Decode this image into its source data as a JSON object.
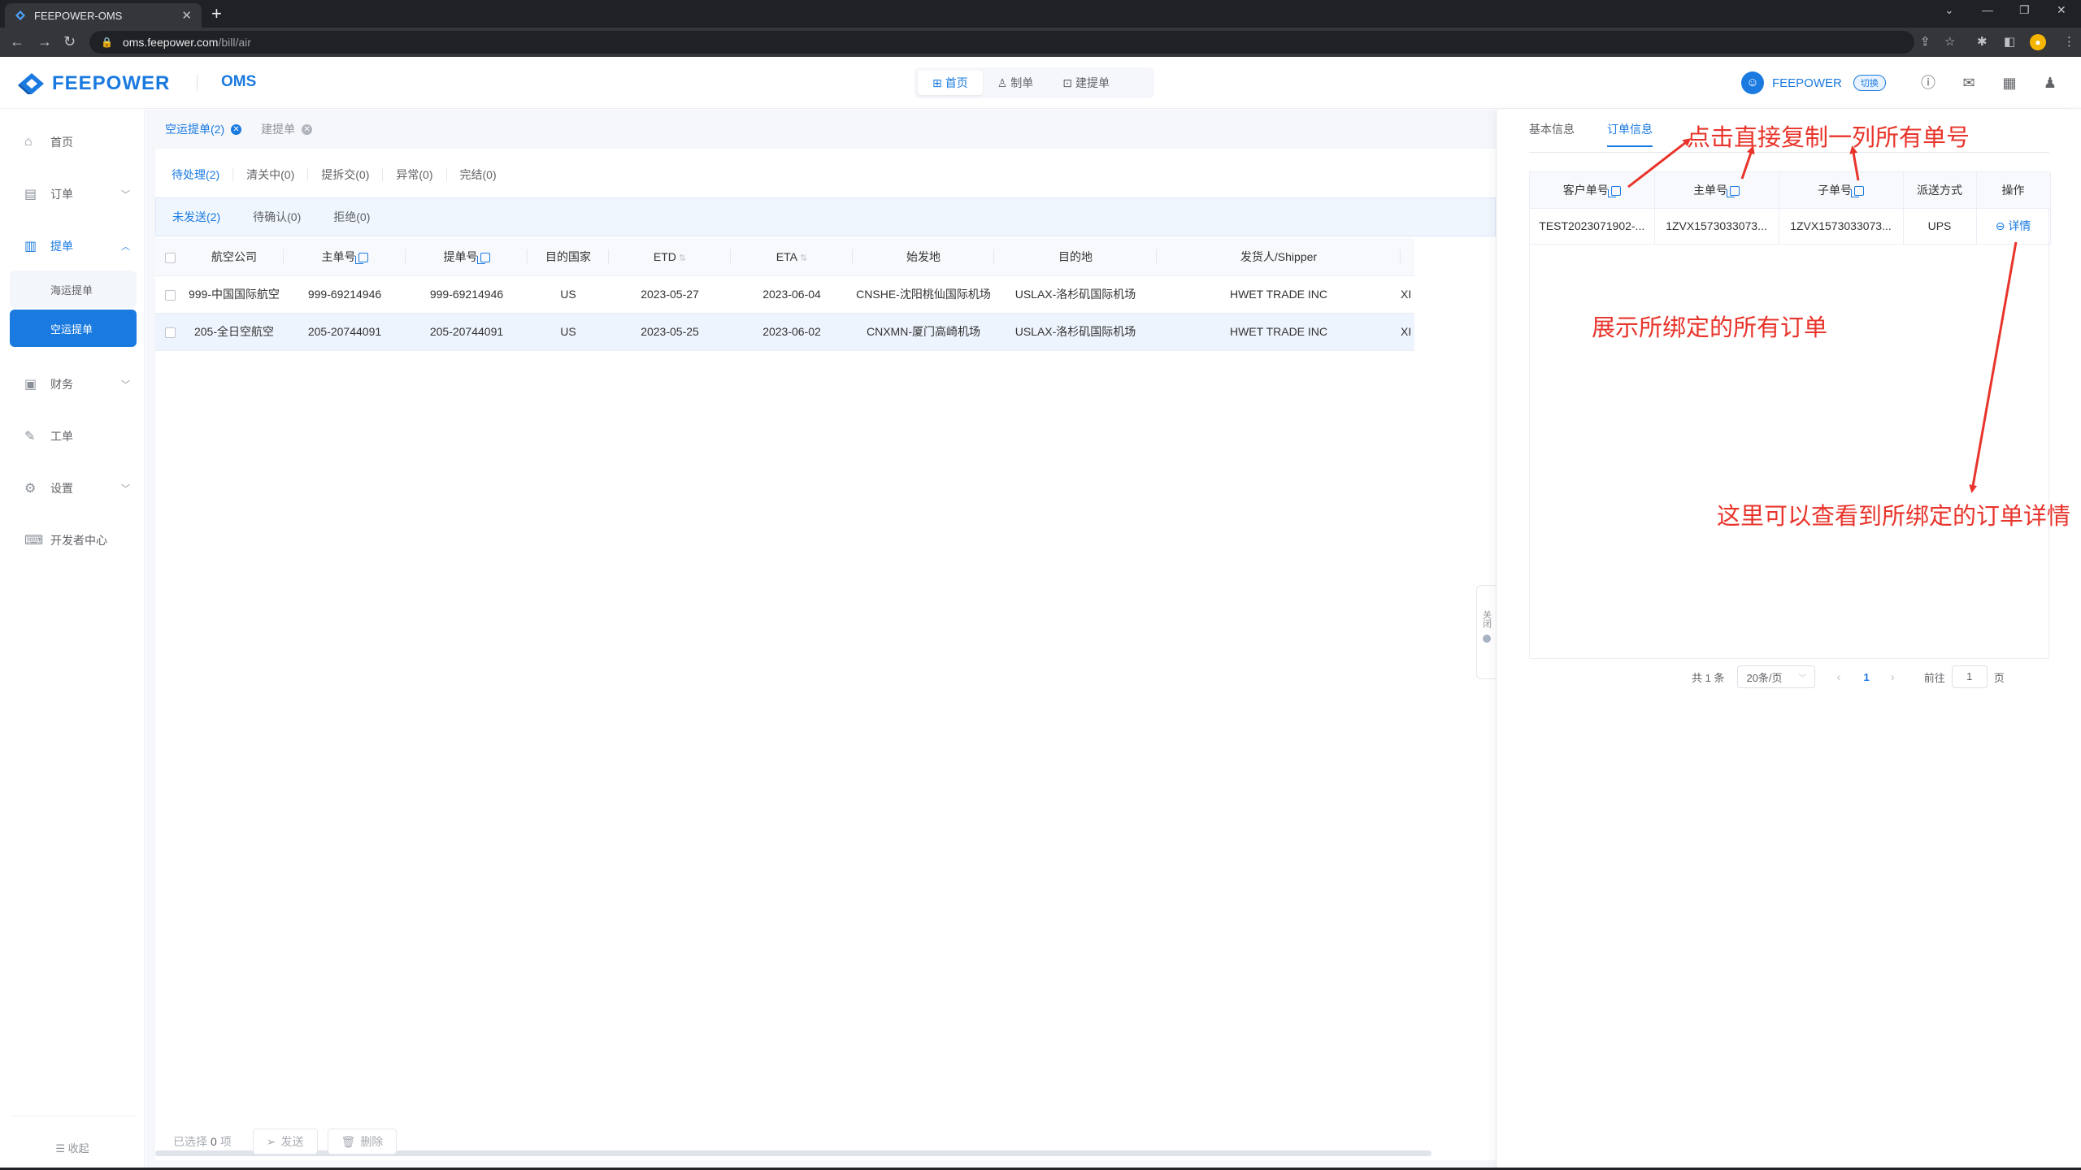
{
  "browser": {
    "tab_title": "FEEPOWER-OMS",
    "tab_close": "✕",
    "new_tab": "+",
    "url_host": "oms.feepower.com",
    "url_path": "/bill/air"
  },
  "header": {
    "logo_text": "FEEPOWER",
    "logo_sub": "OMS",
    "nav": [
      {
        "label": "首页",
        "icon": "grid-icon"
      },
      {
        "label": "制单",
        "icon": "stamp-icon"
      },
      {
        "label": "建提单",
        "icon": "doc-add-icon"
      }
    ],
    "user_name": "FEEPOWER",
    "switch_label": "切换"
  },
  "sidebar": {
    "items": [
      {
        "label": "首页",
        "icon": "home-icon"
      },
      {
        "label": "订单",
        "icon": "order-icon"
      },
      {
        "label": "提单",
        "icon": "bill-icon"
      },
      {
        "label": "财务",
        "icon": "finance-icon"
      },
      {
        "label": "工单",
        "icon": "ticket-icon"
      },
      {
        "label": "设置",
        "icon": "settings-icon"
      },
      {
        "label": "开发者中心",
        "icon": "developer-icon"
      }
    ],
    "sub_items": [
      {
        "label": "海运提单"
      },
      {
        "label": "空运提单"
      }
    ],
    "collapse_label": "收起"
  },
  "main": {
    "page_tabs": [
      {
        "label": "空运提单(2)"
      },
      {
        "label": "建提单"
      }
    ],
    "status_tabs": [
      "待处理(2)",
      "清关中(0)",
      "提拆交(0)",
      "异常(0)",
      "完结(0)"
    ],
    "sub_tabs": [
      "未发送(2)",
      "待确认(0)",
      "拒绝(0)"
    ],
    "table": {
      "columns": [
        "航空公司",
        "主单号",
        "提单号",
        "目的国家",
        "ETD",
        "ETA",
        "始发地",
        "目的地",
        "发货人/Shipper"
      ],
      "rows": [
        {
          "airline": "999-中国国际航空",
          "master_no": "999-69214946",
          "bill_no": "999-69214946",
          "country": "US",
          "etd": "2023-05-27",
          "eta": "2023-06-04",
          "origin": "CNSHE-沈阳桃仙国际机场",
          "destination": "USLAX-洛杉矶国际机场",
          "shipper": "HWET TRADE INC",
          "extra": "XI"
        },
        {
          "airline": "205-全日空航空",
          "master_no": "205-20744091",
          "bill_no": "205-20744091",
          "country": "US",
          "etd": "2023-05-25",
          "eta": "2023-06-02",
          "origin": "CNXMN-厦门高崎机场",
          "destination": "USLAX-洛杉矶国际机场",
          "shipper": "HWET TRADE INC",
          "extra": "XI"
        }
      ]
    },
    "footer": {
      "selected_prefix": "已选择",
      "selected_count": "0",
      "selected_suffix": "项",
      "send_label": "发送",
      "delete_label": "删除"
    }
  },
  "drawer": {
    "tabs": [
      "基本信息",
      "订单信息"
    ],
    "columns": [
      "客户单号",
      "主单号",
      "子单号",
      "派送方式",
      "操作"
    ],
    "rows": [
      {
        "customer_no": "TEST2023071902-...",
        "master_no": "1ZVX1573033073...",
        "child_no": "1ZVX1573033073...",
        "delivery": "UPS",
        "action": "详情"
      }
    ],
    "pagination": {
      "total": "共 1 条",
      "page_size": "20条/页",
      "current": "1",
      "goto_label": "前往",
      "goto_value": "1",
      "page_unit": "页"
    },
    "handle_label": "关闭"
  },
  "annotations": {
    "copy_hint": "点击直接复制一列所有单号",
    "bound_hint": "展示所绑定的所有订单",
    "detail_hint": "这里可以查看到所绑定的订单详情"
  }
}
